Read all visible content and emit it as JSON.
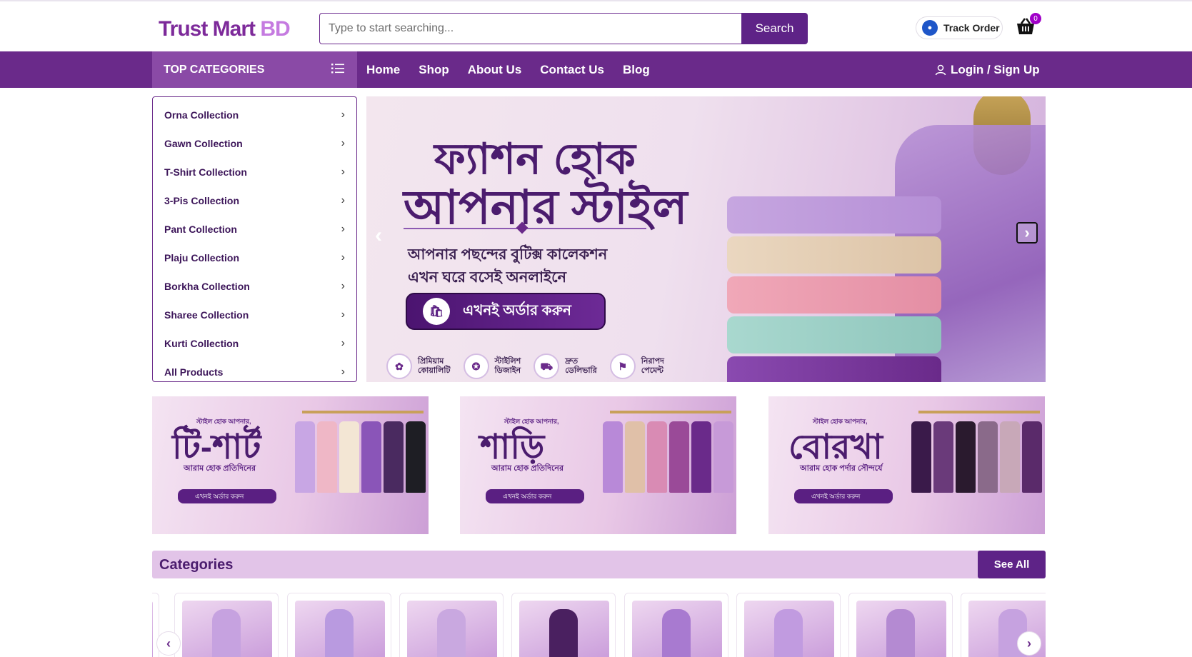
{
  "header": {
    "logo_main": "Trust Mart",
    "logo_accent": "BD",
    "search_placeholder": "Type to start searching...",
    "search_button": "Search",
    "track_order": "Track Order",
    "cart_count": "0"
  },
  "nav": {
    "top_categories": "TOP CATEGORIES",
    "links": [
      "Home",
      "Shop",
      "About Us",
      "Contact Us",
      "Blog"
    ],
    "login": "Login / Sign Up"
  },
  "sidebar": {
    "items": [
      "Orna Collection",
      "Gawn Collection",
      "T-Shirt Collection",
      "3-Pis Collection",
      "Pant Collection",
      "Plaju Collection",
      "Borkha Collection",
      "Sharee Collection",
      "Kurti Collection",
      "All Products"
    ]
  },
  "hero": {
    "title_line1": "ফ্যাশন হোক",
    "title_line2": "আপনার স্টাইল",
    "subtitle_line1": "আপনার পছন্দের বুটিক্স কালেকশন",
    "subtitle_line2": "এখন ঘরে বসেই অনলাইনে",
    "cta": "এখনই অর্ডার করুন",
    "features": [
      {
        "line1": "প্রিমিয়াম",
        "line2": "কোয়ালিটি"
      },
      {
        "line1": "স্টাইলিশ",
        "line2": "ডিজাইন"
      },
      {
        "line1": "দ্রুত",
        "line2": "ডেলিভারি"
      },
      {
        "line1": "নিরাপদ",
        "line2": "পেমেন্ট"
      }
    ]
  },
  "promos": [
    {
      "tag": "স্টাইল হোক আপনার,",
      "title": "টি-শার্ট",
      "sub": "আরাম হোক প্রতিদিনের",
      "button": "এখনই অর্ডার করুন"
    },
    {
      "tag": "স্টাইল হোক আপনার,",
      "title": "শাড়ি",
      "sub": "আরাম হোক প্রতিদিনের",
      "button": "এখনই অর্ডার করুন"
    },
    {
      "tag": "স্টাইল হোক আপনার,",
      "title": "বোরখা",
      "sub": "আরাম হোক পর্দার সৌন্দর্যে",
      "button": "এখনই অর্ডার করুন"
    }
  ],
  "categories": {
    "heading": "Categories",
    "see_all": "See All"
  },
  "colors": {
    "brand_purple": "#6a2a8a",
    "button_purple": "#5e2387",
    "sidebar_header": "#8a4aa6",
    "category_bar": "#e2c4e8"
  },
  "icons": [
    "list-icon",
    "user-icon",
    "cart-icon",
    "track-icon",
    "chevron-right-icon",
    "chevron-left-icon",
    "bag-icon"
  ]
}
